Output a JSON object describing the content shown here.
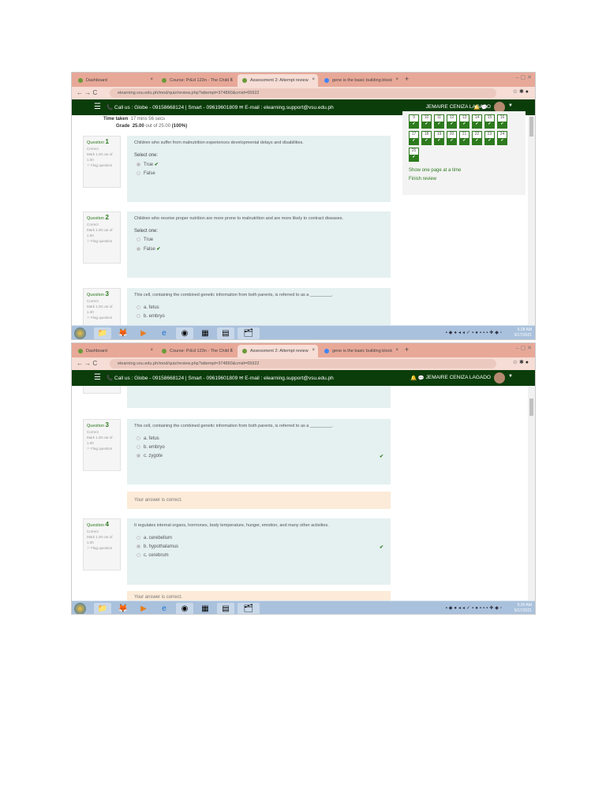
{
  "browser": {
    "tabs": [
      "Dashboard",
      "Course: PrEd 123n - The Child a",
      "Assessment 2: Attempt review",
      "gene is the basic building block"
    ],
    "new_tab": "+",
    "close": "×",
    "url": "elearning.vsu.edu.ph/mod/quiz/review.php?attempt=374860&cmid=65922",
    "nav": "← → C",
    "window_controls": "– ▢ ✕"
  },
  "header": {
    "menu": "☰",
    "contact": "📞 Call us : Globe - 09158668124 | Smart - 09619601809 ✉ E-mail : elearning.support@vsu.edu.ph",
    "user": "JEMAIRE CENIZA LAGADO",
    "icons": "🔔 💬"
  },
  "summary": {
    "time_label": "Time taken",
    "time_value": "17 mins 56 secs",
    "grade_label": "Grade",
    "grade_value": "25.00",
    "grade_rest": "out of 25.00",
    "grade_pct": "(100%)"
  },
  "nav_panel": {
    "rows": [
      [
        "9",
        "10",
        "11",
        "12",
        "13",
        "14",
        "15",
        "16"
      ],
      [
        "17",
        "18",
        "19",
        "20",
        "21",
        "22",
        "23",
        "24"
      ],
      [
        "25"
      ]
    ],
    "check": "✔",
    "show_one_page": "Show one page at a time",
    "finish_review": "Finish review"
  },
  "questions": [
    {
      "label": "Question",
      "num": "1",
      "state": "Correct",
      "mark": "Mark 1.00 out of 1.00",
      "flag": "⚐ Flag question",
      "text": "Children who suffer from malnutrition experiences developmental delays and disabilities.",
      "select": "Select one:",
      "options": [
        "True",
        "False"
      ]
    },
    {
      "label": "Question",
      "num": "2",
      "state": "Correct",
      "mark": "Mark 1.00 out of 1.00",
      "flag": "⚐ Flag question",
      "text": "Children who receive proper nutrition are more prone to malnutrition and are more likely to contract diseases.",
      "select": "Select one:",
      "options": [
        "True",
        "False"
      ]
    },
    {
      "label": "Question",
      "num": "3",
      "state": "Correct",
      "mark": "Mark 1.00 out of 1.00",
      "flag": "⚐ Flag question",
      "text": "This cell, containing the combined genetic information from both parents, is referred to as a _________.",
      "options": [
        "a. fetus",
        "b. embryo",
        "c. zygote"
      ],
      "feedback": "Your answer is correct."
    },
    {
      "label": "Question",
      "num": "4",
      "state": "Correct",
      "mark": "Mark 1.00 out of 1.00",
      "flag": "⚐ Flag question",
      "text": "It regulates internal organs, hormones, body temperature, hunger, emotion, and many other activities.",
      "options": [
        "a. cerebellum",
        "b. hypothalamus",
        "c. cerebrum"
      ],
      "feedback": "Your answer is correct."
    }
  ],
  "taskbar": {
    "clock1_time": "5:28 AM",
    "clock2_time": "5:30 AM",
    "date": "5/17/2021"
  },
  "colors": {
    "brand": "#0b3d0b",
    "accent": "#2d7a1e",
    "question_bg": "#e5f0f0",
    "feedback_bg": "#fcebd8"
  }
}
